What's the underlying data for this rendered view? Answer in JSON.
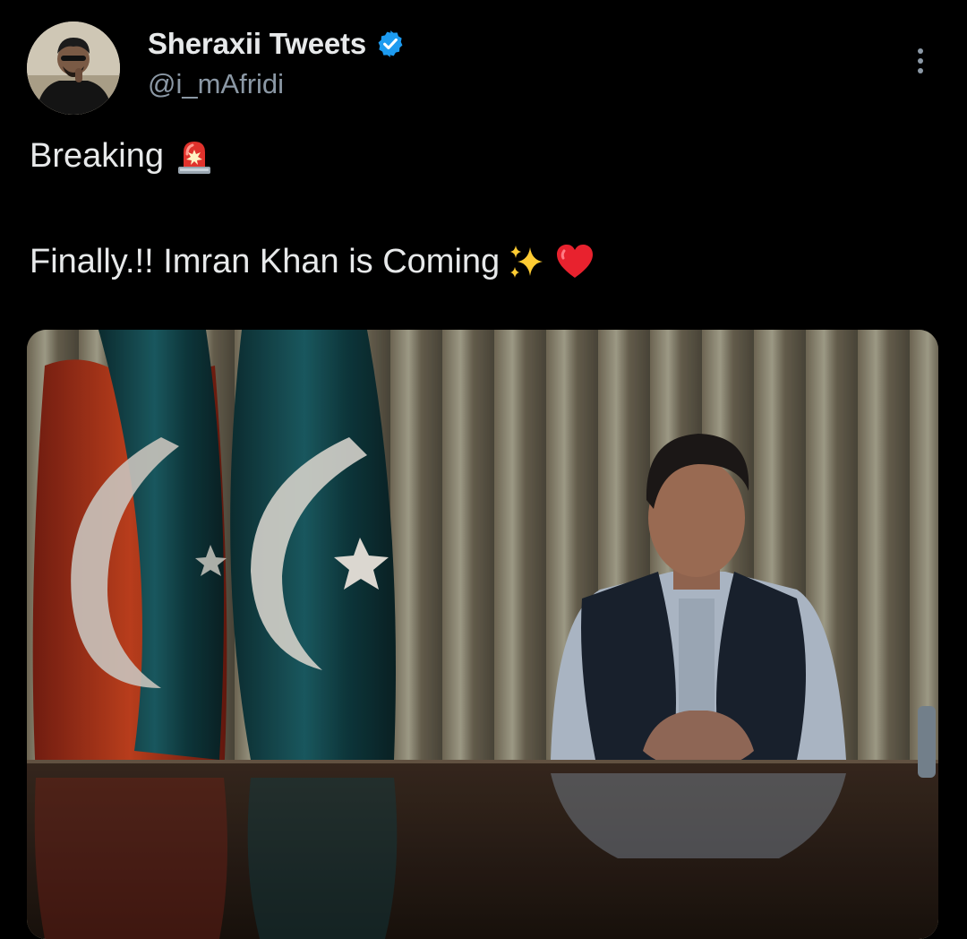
{
  "author": {
    "display_name": "Sheraxii Tweets",
    "handle": "@i_mAfridi",
    "verified": true,
    "avatar_icon": "profile-photo"
  },
  "menu": {
    "icon": "more-options-icon"
  },
  "tweet": {
    "line1": "Breaking",
    "line1_emoji": "police-car-light-emoji",
    "line2": "Finally.!! Imran Khan is Coming",
    "line2_emojis": [
      "sparkles-emoji",
      "red-heart-emoji"
    ]
  },
  "media": {
    "description_icon": "photo-flags-man-at-desk"
  },
  "colors": {
    "background": "#000000",
    "text_primary": "#e7e9ea",
    "text_secondary": "#8b98a5",
    "verified_blue": "#1d9bf0"
  }
}
